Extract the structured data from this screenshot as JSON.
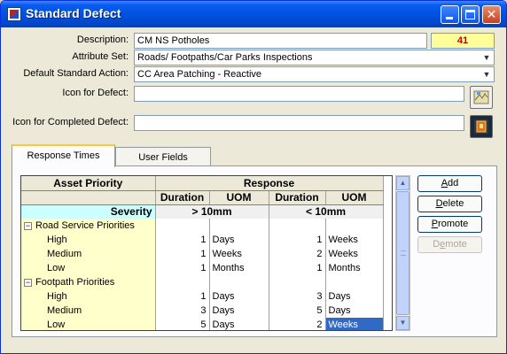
{
  "window": {
    "title": "Standard Defect"
  },
  "form": {
    "description_label": "Description:",
    "description_value": "CM NS Potholes",
    "code_value": "41",
    "attribute_set_label": "Attribute Set:",
    "attribute_set_value": "Roads/ Footpaths/Car Parks Inspections",
    "default_action_label": "Default Standard Action:",
    "default_action_value": "CC Area Patching - Reactive",
    "icon_defect_label": "Icon for Defect:",
    "icon_defect_value": "",
    "icon_completed_label": "Icon for Completed Defect:",
    "icon_completed_value": ""
  },
  "tabs": [
    {
      "label": "Response Times",
      "active": true
    },
    {
      "label": "User Fields",
      "active": false
    }
  ],
  "grid": {
    "header": {
      "asset_priority": "Asset Priority",
      "response": "Response"
    },
    "subheader": {
      "duration1": "Duration",
      "uom1": "UOM",
      "duration2": "Duration",
      "uom2": "UOM"
    },
    "severity": {
      "label": "Severity",
      "col1": "> 10mm",
      "col2": "< 10mm"
    },
    "groups": [
      {
        "name": "Road Service Priorities",
        "expander": "−",
        "rows": [
          {
            "label": "High",
            "d1": "1",
            "u1": "Days",
            "d2": "1",
            "u2": "Weeks"
          },
          {
            "label": "Medium",
            "d1": "1",
            "u1": "Weeks",
            "d2": "2",
            "u2": "Weeks"
          },
          {
            "label": "Low",
            "d1": "1",
            "u1": "Months",
            "d2": "1",
            "u2": "Months"
          }
        ]
      },
      {
        "name": "Footpath Priorities",
        "expander": "−",
        "rows": [
          {
            "label": "High",
            "d1": "1",
            "u1": "Days",
            "d2": "3",
            "u2": "Days"
          },
          {
            "label": "Medium",
            "d1": "3",
            "u1": "Days",
            "d2": "5",
            "u2": "Days"
          },
          {
            "label": "Low",
            "d1": "5",
            "u1": "Days",
            "d2": "2",
            "u2": "Weeks"
          }
        ]
      }
    ]
  },
  "actions": {
    "add": {
      "pre": "",
      "key": "A",
      "post": "dd"
    },
    "delete": {
      "pre": "",
      "key": "D",
      "post": "elete"
    },
    "promote": {
      "pre": "",
      "key": "P",
      "post": "romote"
    },
    "demote": {
      "pre": "D",
      "key": "e",
      "post": "mote"
    }
  },
  "icons": {
    "app": "app-icon",
    "defect_icon_picker": "map-icon",
    "completed_icon_picker": "completed-icon",
    "scroll_up": "arrow-up-icon",
    "scroll_down": "arrow-down-icon",
    "dropdown": "chevron-down-icon"
  },
  "colors": {
    "title_bar": "#0052e0",
    "code_text": "#c00000",
    "code_bg": "#ffff99",
    "severity_bg": "#ccffff",
    "row_label_bg": "#ffffcc",
    "selection": "#316ac5"
  }
}
